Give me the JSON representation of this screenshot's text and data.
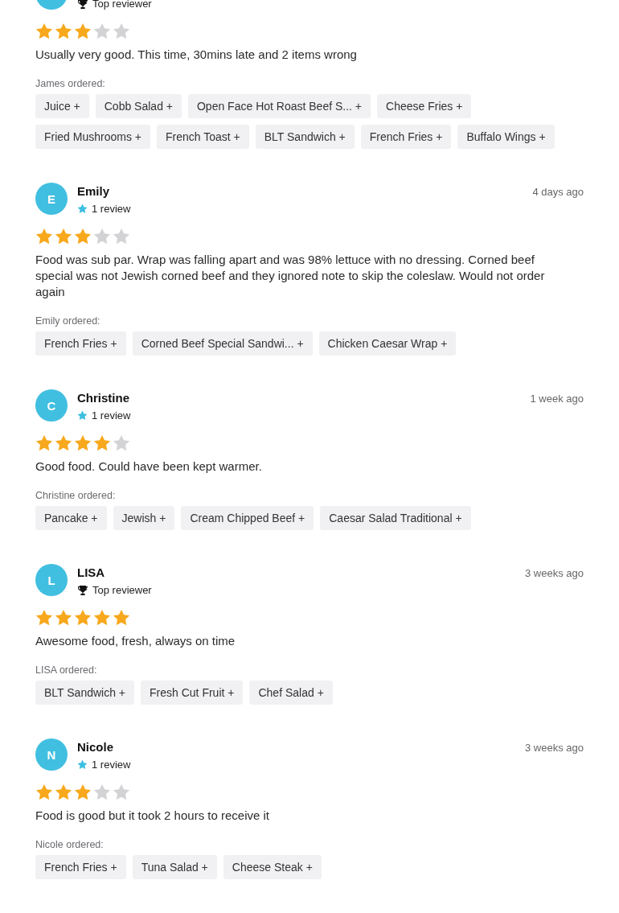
{
  "reviews": [
    {
      "badge": {
        "kind": "top",
        "text": "Top reviewer"
      },
      "stars": 3,
      "text": "Usually very good. This time, 30mins late and 2 items wrong",
      "ordered_label": "James ordered:",
      "items": [
        "Juice +",
        "Cobb Salad +",
        "Open Face Hot Roast Beef S... +",
        "Cheese Fries +",
        "Fried Mushrooms +",
        "French Toast +",
        "BLT Sandwich +",
        "French Fries +",
        "Buffalo Wings +"
      ]
    },
    {
      "initial": "E",
      "name": "Emily",
      "date": "4 days ago",
      "badge": {
        "kind": "count",
        "text": "1 review"
      },
      "stars": 3,
      "text": "Food was sub par. Wrap was falling apart and was 98% lettuce with no dressing. Corned beef special was not Jewish corned beef and they ignored note to skip the coleslaw. Would not order again",
      "ordered_label": "Emily ordered:",
      "items": [
        "French Fries +",
        "Corned Beef Special Sandwi... +",
        "Chicken Caesar Wrap +"
      ]
    },
    {
      "initial": "C",
      "name": "Christine",
      "date": "1 week ago",
      "badge": {
        "kind": "count",
        "text": "1 review"
      },
      "stars": 4,
      "text": "Good food. Could have been kept warmer.",
      "ordered_label": "Christine ordered:",
      "items": [
        "Pancake +",
        "Jewish +",
        "Cream Chipped Beef +",
        "Caesar Salad Traditional +"
      ]
    },
    {
      "initial": "L",
      "name": "LISA",
      "date": "3 weeks ago",
      "badge": {
        "kind": "top",
        "text": "Top reviewer"
      },
      "stars": 5,
      "text": "Awesome food, fresh, always on time",
      "ordered_label": "LISA ordered:",
      "items": [
        "BLT Sandwich +",
        "Fresh Cut Fruit +",
        "Chef Salad +"
      ]
    },
    {
      "initial": "N",
      "name": "Nicole",
      "date": "3 weeks ago",
      "badge": {
        "kind": "count",
        "text": "1 review"
      },
      "stars": 3,
      "text": "Food is good but it took 2 hours to receive it",
      "ordered_label": "Nicole ordered:",
      "items": [
        "French Fries +",
        "Tuna Salad +",
        "Cheese Steak +"
      ]
    }
  ]
}
